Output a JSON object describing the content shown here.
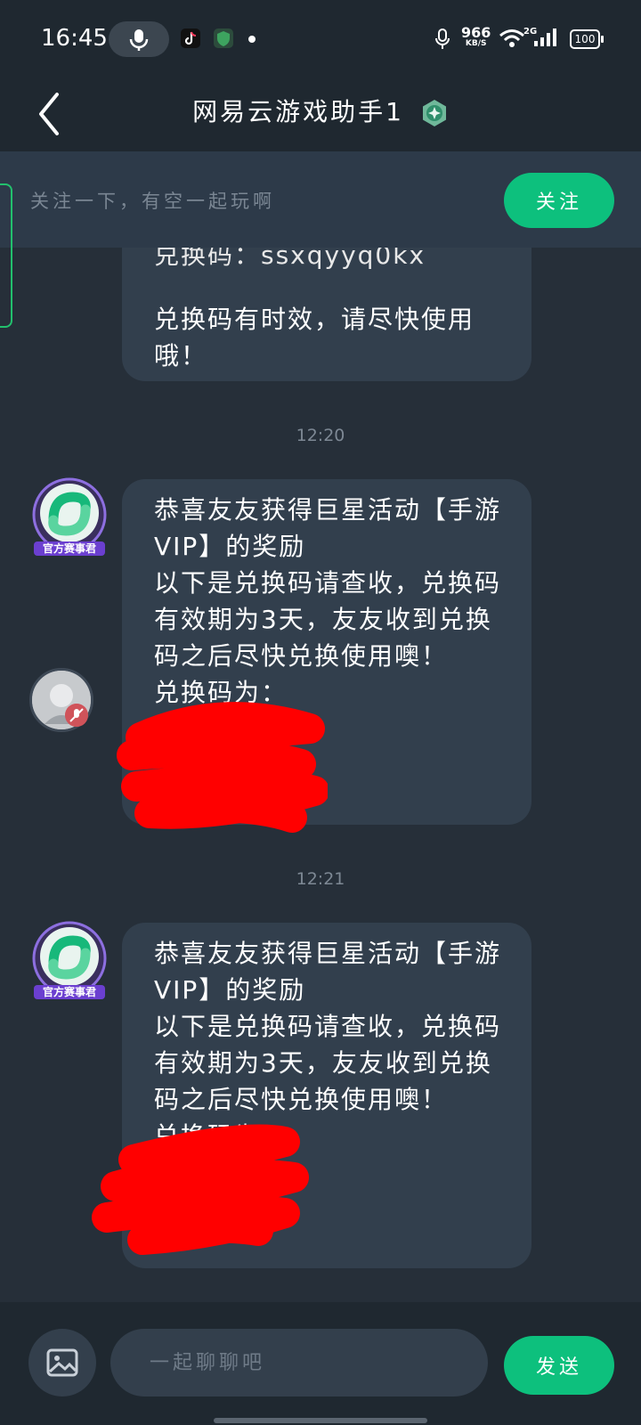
{
  "status_bar": {
    "time": "16:45",
    "net_speed_value": "966",
    "net_speed_unit": "KB/S",
    "signal_label": "2G",
    "battery": "100"
  },
  "header": {
    "title": "网易云游戏助手1",
    "back_icon": "chevron-left-icon",
    "badge_icon": "verified-badge-icon"
  },
  "follow_banner": {
    "text": "关注一下，有空一起玩啊",
    "button_label": "关注"
  },
  "messages": {
    "prev": {
      "code_line": "兑换码：ssxqyyq0kx",
      "note": "兑换码有时效，请尽快使用哦！"
    },
    "time1": "12:20",
    "msg1": {
      "avatar_tag": "官方赛事君",
      "text": "恭喜友友获得巨星活动【手游VIP】的奖励\n以下是兑换码请查收，兑换码有效期为3天，友友收到兑换码之后尽快兑换使用噢！\n兑换码为："
    },
    "time2": "12:21",
    "msg2": {
      "avatar_tag": "官方赛事君",
      "text": "恭喜友友获得巨星活动【手游VIP】的奖励\n以下是兑换码请查收，兑换码有效期为3天，友友收到兑换码之后尽快兑换使用噢！\n兑换码为："
    }
  },
  "input_bar": {
    "placeholder": "一起聊聊吧",
    "send_label": "发送",
    "image_icon": "image-icon"
  },
  "colors": {
    "accent": "#0dc07d",
    "background": "#262f39",
    "bubble": "#323f4d",
    "redaction": "#ff0000"
  }
}
